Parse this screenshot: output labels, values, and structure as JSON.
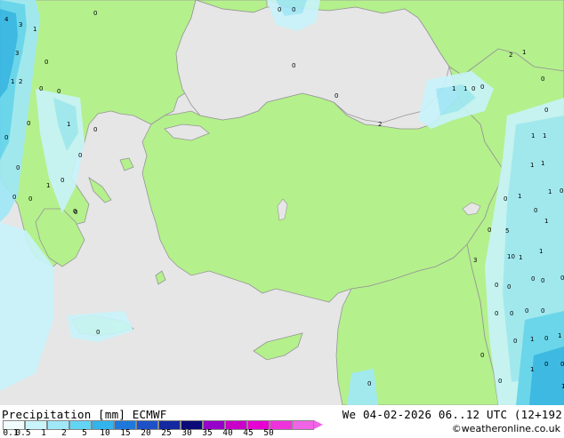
{
  "legend": {
    "title": "Precipitation [mm]  ECMWF",
    "date": "We 04-02-2026 06..12 UTC (12+192",
    "credit": "©weatheronline.co.uk",
    "scale": [
      {
        "label": "0.1",
        "color": "#f0fcfc"
      },
      {
        "label": "0.5",
        "color": "#c8f4fa"
      },
      {
        "label": "1",
        "color": "#a0e8f8"
      },
      {
        "label": "2",
        "color": "#64d4f4"
      },
      {
        "label": "5",
        "color": "#32b4ec"
      },
      {
        "label": "10",
        "color": "#1e78dc"
      },
      {
        "label": "15",
        "color": "#1e50c8"
      },
      {
        "label": "20",
        "color": "#1428a0"
      },
      {
        "label": "25",
        "color": "#0a0a78"
      },
      {
        "label": "30",
        "color": "#9600c8"
      },
      {
        "label": "35",
        "color": "#c800c8"
      },
      {
        "label": "40",
        "color": "#e600d2"
      },
      {
        "label": "45",
        "color": "#f032dc"
      },
      {
        "label": "50",
        "color": "#f064e6"
      }
    ]
  },
  "map": {
    "land_color": "#b4f08c",
    "sea_color": "#e6e6e6",
    "border_color": "#969696",
    "values": [
      "0",
      "0",
      "0",
      "4",
      "3",
      "1",
      "3",
      "0",
      "1",
      "2",
      "0",
      "0",
      "1",
      "0",
      "0",
      "0",
      "0",
      "0",
      "0",
      "0",
      "1",
      "0",
      "0",
      "0",
      "0",
      "2",
      "1",
      "1",
      "0",
      "0",
      "2",
      "1",
      "0",
      "0",
      "1",
      "1",
      "1",
      "1",
      "1",
      "1",
      "0",
      "0",
      "0",
      "1",
      "0",
      "5",
      "3",
      "10",
      "1",
      "1",
      "0",
      "0",
      "0",
      "0",
      "0",
      "0",
      "0",
      "0",
      "0",
      "1",
      "0",
      "1",
      "0",
      "0",
      "1",
      "0",
      "0",
      "1",
      "0",
      "0",
      "0",
      "0"
    ]
  }
}
